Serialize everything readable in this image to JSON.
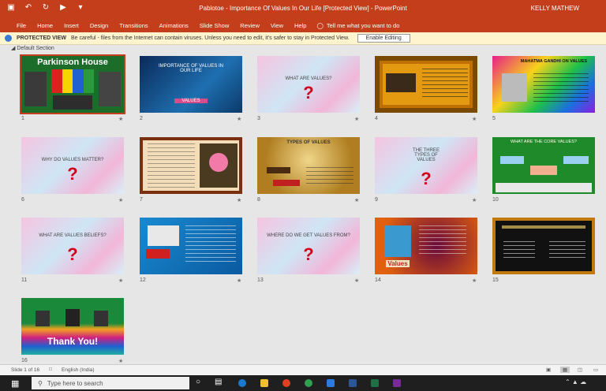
{
  "window": {
    "title": "Pablotoe - Importance Of Values In Our Life [Protected View] - PowerPoint",
    "user": "KELLY MATHEW"
  },
  "ribbon": {
    "tabs": [
      "File",
      "Home",
      "Insert",
      "Design",
      "Transitions",
      "Animations",
      "Slide Show",
      "Review",
      "View",
      "Help"
    ],
    "tell_me": "Tell me what you want to do"
  },
  "protected_view": {
    "label": "PROTECTED VIEW",
    "message": "Be careful - files from the Internet can contain viruses. Unless you need to edit, it's safer to stay in Protected View.",
    "button": "Enable Editing"
  },
  "section_label": "Default Section",
  "slides": [
    {
      "num": "1",
      "title": "Parkinson House"
    },
    {
      "num": "2",
      "title": "IMPORTANCE OF VALUES IN OUR LIFE",
      "subtitle": "VALUES"
    },
    {
      "num": "3",
      "title": "WHAT ARE VALUES?"
    },
    {
      "num": "4"
    },
    {
      "num": "5",
      "title": "MAHATMA GANDHI ON VALUES"
    },
    {
      "num": "6",
      "title": "WHY DO VALUES MATTER?"
    },
    {
      "num": "7"
    },
    {
      "num": "8",
      "title": "TYPES OF VALUES"
    },
    {
      "num": "9",
      "title": "THE THREE TYPES OF VALUES"
    },
    {
      "num": "10",
      "title": "WHAT ARE THE CORE VALUES?"
    },
    {
      "num": "11",
      "title": "WHAT ARE VALUES BELIEFS?"
    },
    {
      "num": "12"
    },
    {
      "num": "13",
      "title": "WHERE DO WE GET VALUES FROM?"
    },
    {
      "num": "14",
      "title": "Values"
    },
    {
      "num": "15"
    },
    {
      "num": "16",
      "title": "Thank You!"
    }
  ],
  "status": {
    "slide_info": "Slide 1 of 16",
    "language": "English (India)"
  },
  "taskbar": {
    "search_placeholder": "Type here to search"
  },
  "colors": {
    "accent": "#c43e1c",
    "pv_bar": "#fff4ce"
  }
}
